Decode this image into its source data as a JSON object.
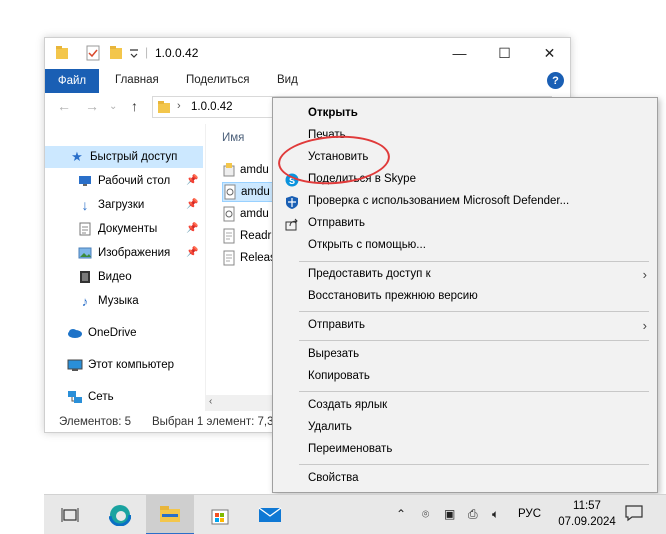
{
  "window": {
    "title": "1.0.0.42",
    "minimize": "—",
    "maximize": "☐",
    "close": "✕"
  },
  "ribbon": {
    "tabs": [
      "Файл",
      "Главная",
      "Поделиться",
      "Вид"
    ],
    "help": "?"
  },
  "address": {
    "path": "1.0.0.42"
  },
  "nav": {
    "items": [
      {
        "label": "Быстрый доступ",
        "icon": "star-icon"
      },
      {
        "label": "Рабочий стол",
        "icon": "desktop-icon",
        "pinned": true
      },
      {
        "label": "Загрузки",
        "icon": "download-icon",
        "pinned": true
      },
      {
        "label": "Документы",
        "icon": "documents-icon",
        "pinned": true
      },
      {
        "label": "Изображения",
        "icon": "pictures-icon",
        "pinned": true
      },
      {
        "label": "Видео",
        "icon": "video-icon"
      },
      {
        "label": "Музыка",
        "icon": "music-icon"
      },
      {
        "label": "OneDrive",
        "icon": "cloud-icon"
      },
      {
        "label": "Этот компьютер",
        "icon": "computer-icon"
      },
      {
        "label": "Сеть",
        "icon": "network-icon"
      }
    ]
  },
  "files": {
    "column_header": "Имя",
    "items": [
      "amdu",
      "amdu",
      "amdu",
      "Readr",
      "Releas"
    ]
  },
  "status": {
    "count": "Элементов: 5",
    "selected": "Выбран 1 элемент: 7,3"
  },
  "context_menu": {
    "items": [
      {
        "label": "Открыть",
        "bold": true
      },
      {
        "label": "Печать"
      },
      {
        "label": "Установить"
      },
      {
        "label": "Поделиться в Skype",
        "icon": "skype-icon"
      },
      {
        "label": "Проверка с использованием Microsoft Defender...",
        "icon": "defender-icon"
      },
      {
        "label": "Отправить",
        "icon": "share-icon"
      },
      {
        "label": "Открыть с помощью..."
      },
      {
        "label": "Предоставить доступ к",
        "submenu": true
      },
      {
        "label": "Восстановить прежнюю версию"
      },
      {
        "label": "Отправить",
        "submenu": true
      },
      {
        "label": "Вырезать"
      },
      {
        "label": "Копировать"
      },
      {
        "label": "Создать ярлык"
      },
      {
        "label": "Удалить"
      },
      {
        "label": "Переименовать"
      },
      {
        "label": "Свойства"
      }
    ]
  },
  "taskbar": {
    "apps": [
      "task-view-icon",
      "edge-icon",
      "file-explorer-icon",
      "store-icon",
      "mail-icon"
    ],
    "tray": {
      "lang": "РУС",
      "time": "11:57",
      "date": "07.09.2024"
    }
  },
  "colors": {
    "accent": "#1a5fb4",
    "selection": "#cce8ff",
    "annotation": "#e03a3a"
  }
}
